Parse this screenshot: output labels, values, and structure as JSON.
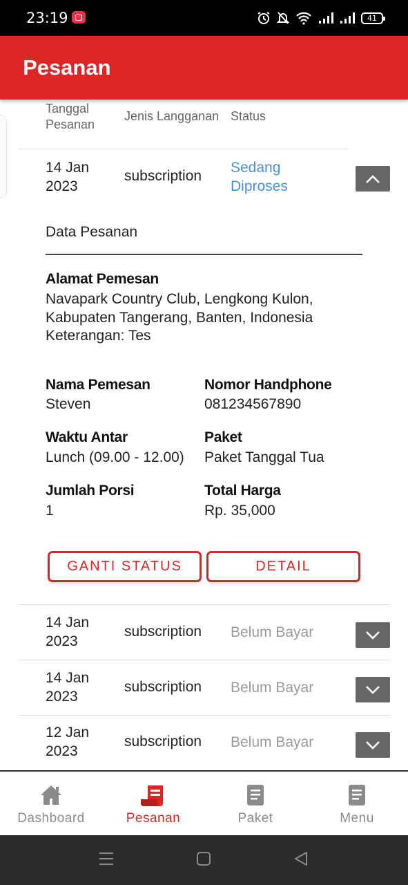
{
  "status_bar": {
    "time": "23:19",
    "battery": "41",
    "icons": [
      "screen-record-icon",
      "alarm-icon",
      "mute-icon",
      "wifi-icon",
      "signal-icon",
      "signal-icon",
      "battery-icon"
    ]
  },
  "app_bar": {
    "title": "Pesanan",
    "color": "#dc2626"
  },
  "table": {
    "headers": {
      "date": "Tanggal Pesanan",
      "type": "Jenis Langganan",
      "status": "Status"
    }
  },
  "orders": [
    {
      "date": "14 Jan 2023",
      "type": "subscription",
      "status": "Sedang Diproses",
      "expanded": true
    },
    {
      "date": "14 Jan 2023",
      "type": "subscription",
      "status": "Belum Bayar",
      "expanded": false
    },
    {
      "date": "14 Jan 2023",
      "type": "subscription",
      "status": "Belum Bayar",
      "expanded": false
    },
    {
      "date": "12 Jan 2023",
      "type": "subscription",
      "status": "Belum Bayar",
      "expanded": false
    }
  ],
  "detail": {
    "heading": "Data Pesanan",
    "address_label": "Alamat Pemesan",
    "address_lines": [
      "Navapark Country Club, Lengkong Kulon,",
      "Kabupaten Tangerang, Banten, Indonesia",
      "Keterangan: Tes"
    ],
    "name_label": "Nama Pemesan",
    "name": "Steven",
    "phone_label": "Nomor Handphone",
    "phone": "081234567890",
    "delivery_label": "Waktu Antar",
    "delivery": "Lunch (09.00 - 12.00)",
    "package_label": "Paket",
    "package": "Paket Tanggal Tua",
    "portion_label": "Jumlah Porsi",
    "portion": "1",
    "total_label": "Total Harga",
    "total": "Rp. 35,000",
    "change_status_button": "GANTI STATUS",
    "detail_button": "DETAIL"
  },
  "bottom_nav": [
    {
      "label": "Dashboard",
      "icon": "home-icon",
      "active": false
    },
    {
      "label": "Pesanan",
      "icon": "receipt-icon",
      "active": true
    },
    {
      "label": "Paket",
      "icon": "document-icon",
      "active": false
    },
    {
      "label": "Menu",
      "icon": "document-icon",
      "active": false
    }
  ],
  "colors": {
    "accent": "#dc2626",
    "status_processing": "#4a90d9",
    "status_unpaid": "#9a9a9a"
  }
}
